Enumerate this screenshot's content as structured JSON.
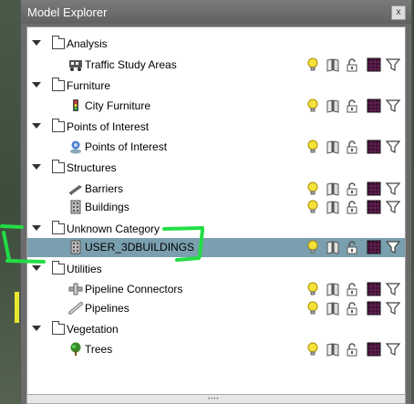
{
  "window": {
    "title": "Model Explorer",
    "close_glyph": "x"
  },
  "tree": [
    {
      "type": "category",
      "label": "Analysis"
    },
    {
      "type": "item",
      "label": "Traffic Study Areas",
      "icon": "traffic-study-icon"
    },
    {
      "type": "category",
      "label": "Furniture"
    },
    {
      "type": "item",
      "label": "City Furniture",
      "icon": "traffic-light-icon"
    },
    {
      "type": "category",
      "label": "Points of Interest"
    },
    {
      "type": "item",
      "label": "Points of Interest",
      "icon": "poi-pin-icon"
    },
    {
      "type": "category",
      "label": "Structures"
    },
    {
      "type": "item",
      "label": "Barriers",
      "icon": "barrier-icon"
    },
    {
      "type": "item",
      "label": "Buildings",
      "icon": "building-icon"
    },
    {
      "type": "category",
      "label": "Unknown Category"
    },
    {
      "type": "item",
      "label": "USER_3DBUILDINGS",
      "icon": "building-icon",
      "selected": true
    },
    {
      "type": "category",
      "label": "Utilities"
    },
    {
      "type": "item",
      "label": "Pipeline Connectors",
      "icon": "pipeline-connector-icon"
    },
    {
      "type": "item",
      "label": "Pipelines",
      "icon": "pipeline-icon"
    },
    {
      "type": "category",
      "label": "Vegetation"
    },
    {
      "type": "item",
      "label": "Trees",
      "icon": "tree-icon"
    }
  ],
  "item_controls": [
    "lightbulb-icon",
    "book-icon",
    "lock-icon",
    "texture-icon",
    "filter-icon"
  ],
  "colors": {
    "selected_row": "#7a9fae",
    "annotation": "#22dd44"
  }
}
